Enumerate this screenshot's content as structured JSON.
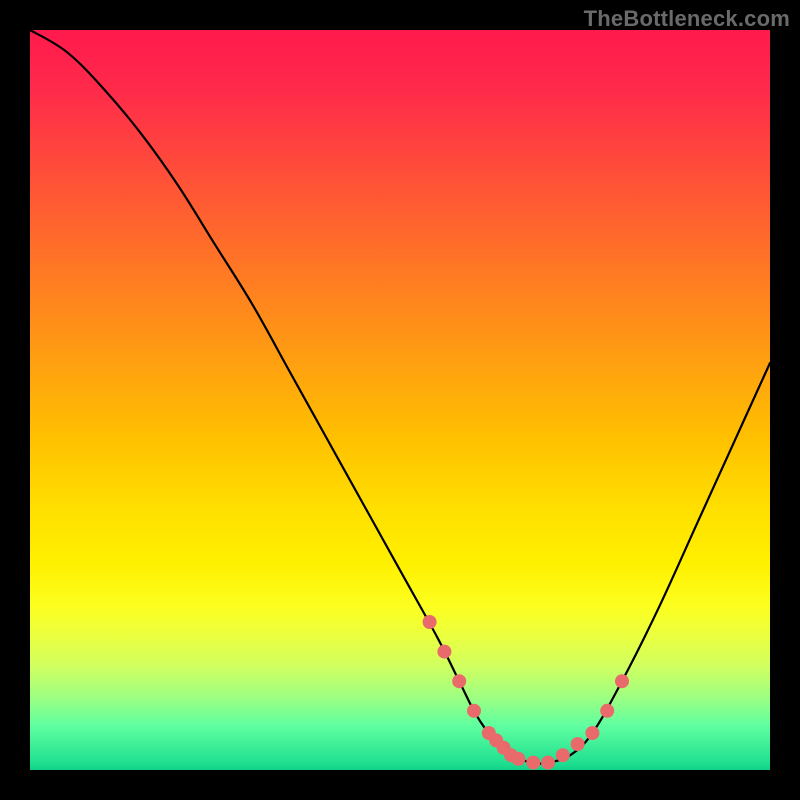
{
  "watermark": "TheBottleneck.com",
  "chart_data": {
    "type": "line",
    "title": "",
    "xlabel": "",
    "ylabel": "",
    "xlim": [
      0,
      100
    ],
    "ylim": [
      0,
      100
    ],
    "grid": false,
    "series": [
      {
        "name": "bottleneck-curve",
        "x": [
          0,
          5,
          10,
          15,
          20,
          25,
          30,
          35,
          40,
          45,
          50,
          55,
          58,
          60,
          62,
          65,
          68,
          70,
          73,
          76,
          80,
          85,
          90,
          95,
          100
        ],
        "y": [
          100,
          97,
          92,
          86,
          79,
          71,
          63,
          54,
          45,
          36,
          27,
          18,
          12,
          8,
          5,
          2,
          1,
          1,
          2,
          5,
          12,
          22,
          33,
          44,
          55
        ]
      }
    ],
    "highlight_points": {
      "name": "flat-zone-dots",
      "x": [
        54,
        56,
        58,
        60,
        62,
        63,
        64,
        65,
        66,
        68,
        70,
        72,
        74,
        76,
        78,
        80
      ],
      "y": [
        20,
        16,
        12,
        8,
        5,
        4,
        3,
        2,
        1.5,
        1,
        1,
        2,
        3.5,
        5,
        8,
        12
      ]
    },
    "background_gradient": {
      "top": "#ff1a4d",
      "mid": "#ffe000",
      "bottom": "#10d088"
    }
  }
}
